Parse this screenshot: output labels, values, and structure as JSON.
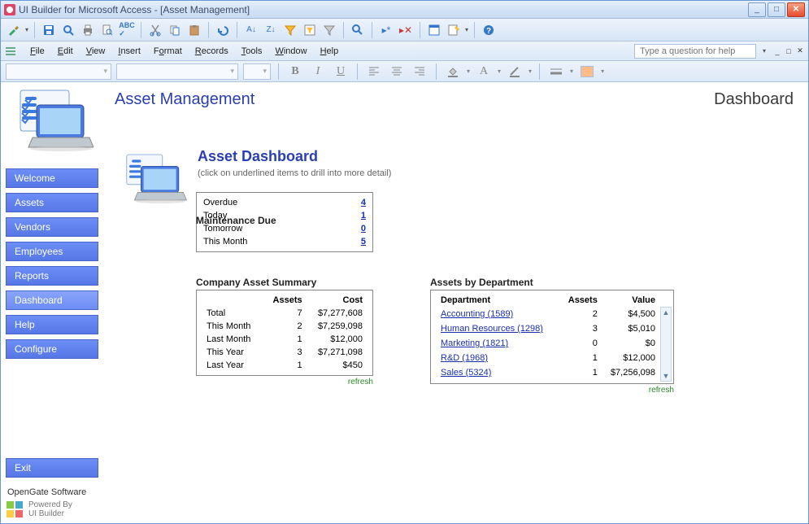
{
  "window": {
    "title": "UI Builder for Microsoft Access - [Asset Management]"
  },
  "menus": {
    "file": "File",
    "edit": "Edit",
    "view": "View",
    "insert": "Insert",
    "format": "Format",
    "records": "Records",
    "tools": "Tools",
    "window": "Window",
    "help": "Help",
    "help_placeholder": "Type a question for help"
  },
  "sidebar": {
    "items": [
      {
        "label": "Welcome"
      },
      {
        "label": "Assets"
      },
      {
        "label": "Vendors"
      },
      {
        "label": "Employees"
      },
      {
        "label": "Reports"
      },
      {
        "label": "Dashboard"
      },
      {
        "label": "Help"
      },
      {
        "label": "Configure"
      }
    ],
    "exit": "Exit",
    "footer": "OpenGate Software",
    "powered1": "Powered By",
    "powered2": "UI Builder"
  },
  "header": {
    "title": "Asset Management",
    "location": "Dashboard"
  },
  "dashboard": {
    "title": "Asset Dashboard",
    "subtitle": "(click on underlined items to drill into more detail)",
    "maintenance": {
      "title": "Maintenance Due",
      "rows": [
        {
          "label": "Overdue",
          "value": "4"
        },
        {
          "label": "Today",
          "value": "1"
        },
        {
          "label": "Tomorrow",
          "value": "0"
        },
        {
          "label": "This Month",
          "value": "5"
        }
      ]
    },
    "summary": {
      "title": "Company Asset Summary",
      "col_assets": "Assets",
      "col_cost": "Cost",
      "rows": [
        {
          "label": "Total",
          "assets": "7",
          "cost": "$7,277,608"
        },
        {
          "label": "This Month",
          "assets": "2",
          "cost": "$7,259,098"
        },
        {
          "label": "Last Month",
          "assets": "1",
          "cost": "$12,000"
        },
        {
          "label": "This Year",
          "assets": "3",
          "cost": "$7,271,098"
        },
        {
          "label": "Last Year",
          "assets": "1",
          "cost": "$450"
        }
      ],
      "refresh": "refresh"
    },
    "departments": {
      "title": "Assets by Department",
      "col_dept": "Department",
      "col_assets": "Assets",
      "col_value": "Value",
      "rows": [
        {
          "dept": "Accounting (1589)",
          "assets": "2",
          "value": "$4,500"
        },
        {
          "dept": "Human Resources (1298)",
          "assets": "3",
          "value": "$5,010"
        },
        {
          "dept": "Marketing (1821)",
          "assets": "0",
          "value": "$0"
        },
        {
          "dept": "R&D (1968)",
          "assets": "1",
          "value": "$12,000"
        },
        {
          "dept": "Sales (5324)",
          "assets": "1",
          "value": "$7,256,098"
        }
      ],
      "refresh": "refresh"
    }
  }
}
